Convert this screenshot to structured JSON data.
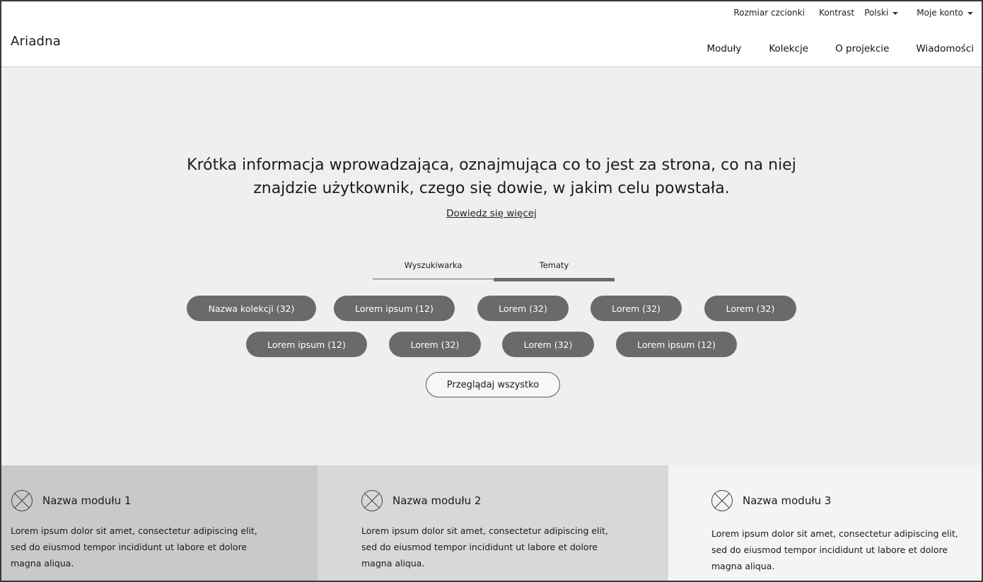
{
  "header": {
    "logo": "Ariadna",
    "utility": {
      "font_size": "Rozmiar czcionki",
      "contrast": "Kontrast",
      "language": "Polski",
      "account": "Moje konto"
    },
    "nav": [
      "Moduły",
      "Kolekcje",
      "O projekcie",
      "Wiadomości"
    ]
  },
  "hero": {
    "intro_line1": "Krótka informacja wprowadzająca, oznajmująca co to jest za strona, co na niej",
    "intro_line2": "znajdzie użytkownik, czego się dowie, w jakim celu powstała.",
    "more_link": "Dowiedz się więcej",
    "tabs": [
      {
        "label": "Wyszukiwarka",
        "active": false
      },
      {
        "label": "Tematy",
        "active": true
      }
    ],
    "pills_row1": [
      "Nazwa kolekcji (32)",
      "Lorem ipsum (12)",
      "Lorem (32)",
      "Lorem (32)",
      "Lorem (32)"
    ],
    "pills_row2": [
      "Lorem ipsum (12)",
      "Lorem (32)",
      "Lorem (32)",
      "Lorem ipsum (12)"
    ],
    "browse_all": "Przeglądaj wszystko"
  },
  "modules": [
    {
      "title": "Nazwa modułu 1",
      "line1": "Lorem ipsum dolor sit amet, consectetur adipiscing elit,",
      "line2": "sed do eiusmod tempor incididunt ut labore et dolore",
      "line3": "magna aliqua."
    },
    {
      "title": "Nazwa modułu 2",
      "line1": "Lorem ipsum dolor sit amet, consectetur adipiscing elit,",
      "line2": "sed do eiusmod tempor incididunt ut labore et dolore",
      "line3": "magna aliqua."
    },
    {
      "title": "Nazwa modułu 3",
      "line1": "Lorem ipsum dolor sit amet, consectetur adipiscing elit,",
      "line2": "sed do eiusmod tempor incididunt ut labore et dolore",
      "line3": "magna aliqua."
    }
  ],
  "colors": {
    "pill_bg": "#6a6a6a",
    "hero_bg": "#efefef",
    "module1_bg": "#c9c9c9",
    "module2_bg": "#d8d8d8",
    "module3_bg": "#f4f4f4"
  }
}
